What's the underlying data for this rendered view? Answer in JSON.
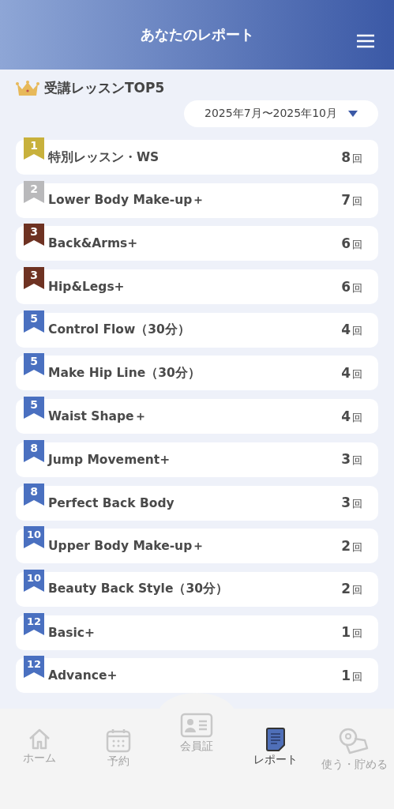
{
  "header": {
    "title": "あなたのレポート"
  },
  "section": {
    "title": "受講レッスンTOP5",
    "period": "2025年7月〜2025年10月"
  },
  "ranking": [
    {
      "rank": "1",
      "color": "#c8b13c",
      "name": "特別レッスン・WS",
      "count": "8",
      "unit": "回"
    },
    {
      "rank": "2",
      "color": "#b9b9bb",
      "name": "Lower Body Make-up＋",
      "count": "7",
      "unit": "回"
    },
    {
      "rank": "3",
      "color": "#6e3222",
      "name": "Back&Arms+",
      "count": "6",
      "unit": "回"
    },
    {
      "rank": "3",
      "color": "#6e3222",
      "name": "Hip&Legs+",
      "count": "6",
      "unit": "回"
    },
    {
      "rank": "5",
      "color": "#4a70c0",
      "name": "Control Flow（30分）",
      "count": "4",
      "unit": "回"
    },
    {
      "rank": "5",
      "color": "#4a70c0",
      "name": "Make Hip Line（30分）",
      "count": "4",
      "unit": "回"
    },
    {
      "rank": "5",
      "color": "#4a70c0",
      "name": "Waist Shape＋",
      "count": "4",
      "unit": "回"
    },
    {
      "rank": "8",
      "color": "#4a70c0",
      "name": "Jump Movement+",
      "count": "3",
      "unit": "回"
    },
    {
      "rank": "8",
      "color": "#4a70c0",
      "name": "Perfect Back Body",
      "count": "3",
      "unit": "回"
    },
    {
      "rank": "10",
      "color": "#4a70c0",
      "name": "Upper Body Make-up＋",
      "count": "2",
      "unit": "回"
    },
    {
      "rank": "10",
      "color": "#4a70c0",
      "name": "Beauty Back Style（30分）",
      "count": "2",
      "unit": "回"
    },
    {
      "rank": "12",
      "color": "#4a70c0",
      "name": "Basic+",
      "count": "1",
      "unit": "回"
    },
    {
      "rank": "12",
      "color": "#4a70c0",
      "name": "Advance+",
      "count": "1",
      "unit": "回"
    }
  ],
  "nav": [
    {
      "kind": "home",
      "label": "ホーム",
      "selected": false
    },
    {
      "kind": "calendar",
      "label": "予約",
      "selected": false
    },
    {
      "kind": "card",
      "label": "会員証",
      "selected": false
    },
    {
      "kind": "report",
      "label": "レポート",
      "selected": true
    },
    {
      "kind": "coin",
      "label": "使う・貯める",
      "selected": false
    }
  ]
}
